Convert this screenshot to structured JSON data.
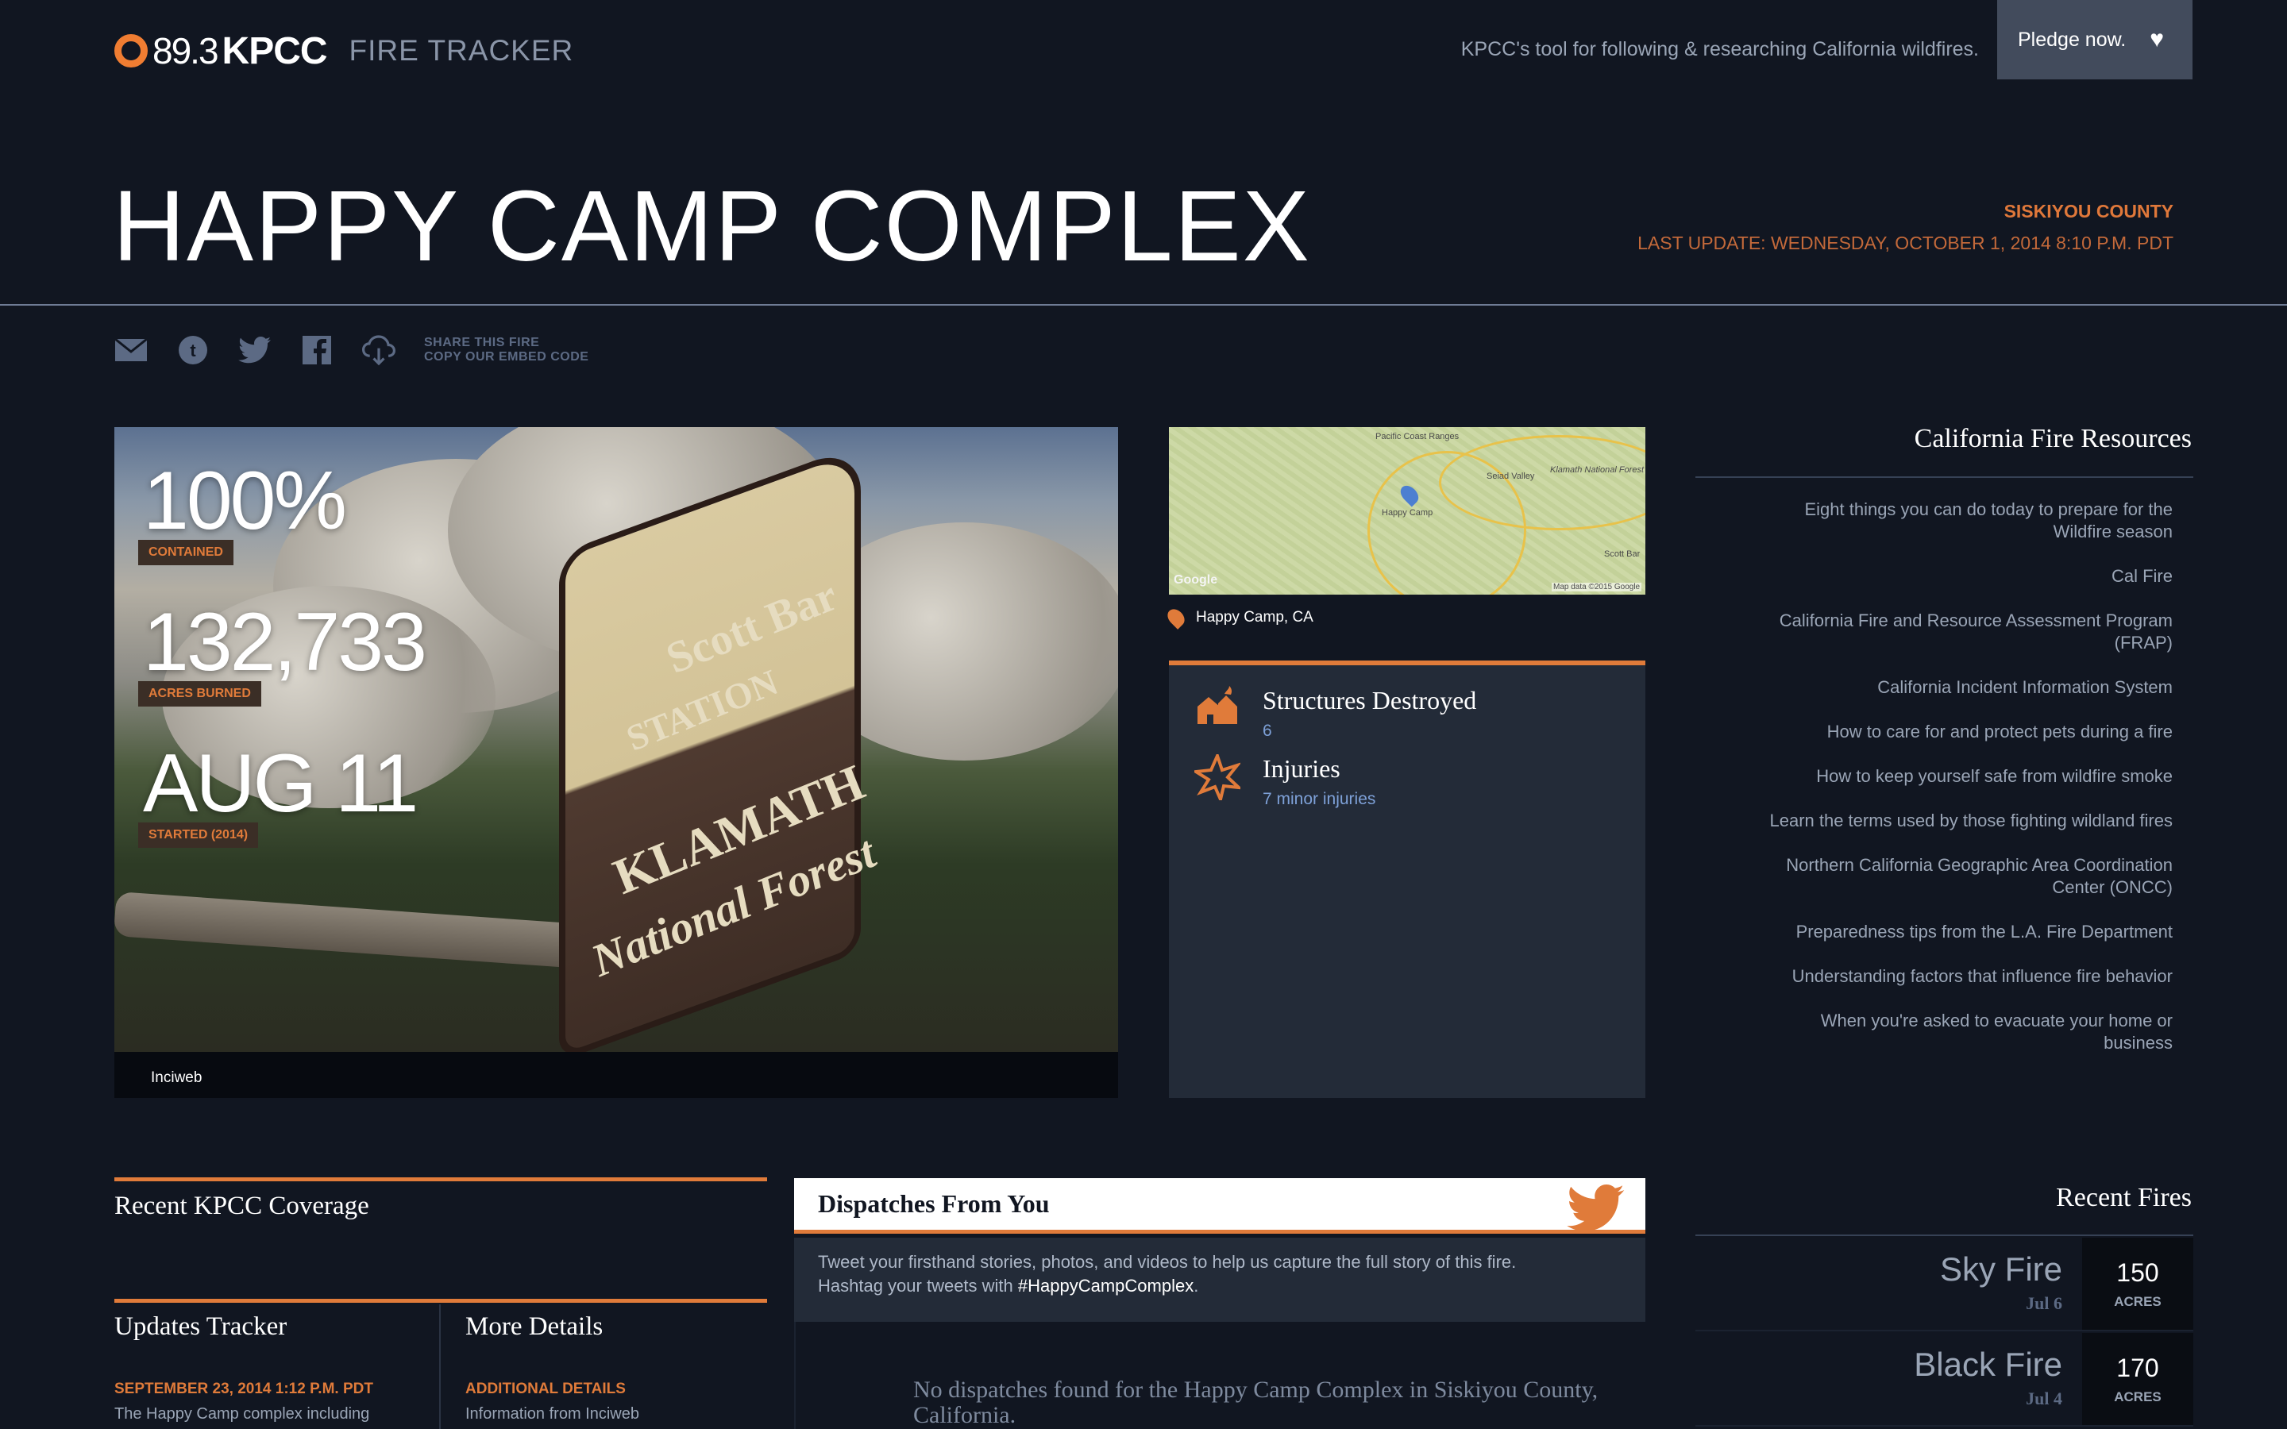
{
  "header": {
    "logo_freq": "89.3",
    "logo_station": "KPCC",
    "logo_product": "FIRE TRACKER",
    "tagline": "KPCC's tool for following & researching California wildfires.",
    "pledge_label": "Pledge now."
  },
  "fire": {
    "name": "HAPPY CAMP COMPLEX",
    "county": "SISKIYOU COUNTY",
    "last_update": "LAST UPDATE: WEDNESDAY, OCTOBER 1, 2014 8:10 P.M. PDT"
  },
  "share": {
    "title": "SHARE THIS FIRE",
    "subtitle": "COPY OUR EMBED CODE",
    "icons": [
      "email-icon",
      "tumblr-icon",
      "twitter-icon",
      "facebook-icon",
      "cloud-embed-icon"
    ]
  },
  "stats": {
    "contained_value": "100%",
    "contained_label": "CONTAINED",
    "acres_value": "132,733",
    "acres_label": "ACRES BURNED",
    "started_value": "AUG 11",
    "started_label": "STARTED (2014)",
    "photo_credit": "Inciweb"
  },
  "map": {
    "labels": [
      "Pacific Coast Ranges",
      "Seiad Valley",
      "Klamath National Forest",
      "Happy Camp",
      "Scott Bar",
      "Google",
      "Map data ©2015 Google"
    ],
    "location": "Happy Camp, CA"
  },
  "impact": {
    "structures_title": "Structures Destroyed",
    "structures_value": "6",
    "injuries_title": "Injuries",
    "injuries_value": "7 minor injuries"
  },
  "resources": {
    "title": "California Fire Resources",
    "items": [
      "Eight things you can do today to prepare for the Wildfire season",
      "Cal Fire",
      "California Fire and Resource Assessment Program (FRAP)",
      "California Incident Information System",
      "How to care for and protect pets during a fire",
      "How to keep yourself safe from wildfire smoke",
      "Learn the terms used by those fighting wildland fires",
      "Northern California Geographic Area Coordination Center (ONCC)",
      "Preparedness tips from the L.A. Fire Department",
      "Understanding factors that influence fire behavior",
      "When you're asked to evacuate your home or business"
    ]
  },
  "coverage": {
    "title": "Recent KPCC Coverage"
  },
  "updates": {
    "title": "Updates Tracker",
    "date": "SEPTEMBER 23, 2014 1:12 P.M. PDT",
    "text": "The Happy Camp complex including"
  },
  "details": {
    "title": "More Details",
    "label": "ADDITIONAL DETAILS",
    "text": "Information from Inciweb"
  },
  "dispatches": {
    "title": "Dispatches From You",
    "body_line1": "Tweet your firsthand stories, photos, and videos to help us capture the full story of this fire.",
    "body_line2_prefix": "Hashtag your tweets with",
    "hashtag": "#HappyCampComplex",
    "body_line2_suffix": ".",
    "empty": "No dispatches found for the Happy Camp Complex in Siskiyou County, California."
  },
  "recent_fires": {
    "title": "Recent Fires",
    "items": [
      {
        "name": "Sky Fire",
        "date": "Jul 6",
        "acres": "150",
        "unit": "ACRES"
      },
      {
        "name": "Black Fire",
        "date": "Jul 4",
        "acres": "170",
        "unit": "ACRES"
      }
    ]
  },
  "colors": {
    "background": "#111621",
    "accent": "#e07b3a",
    "panel": "#232b38"
  }
}
